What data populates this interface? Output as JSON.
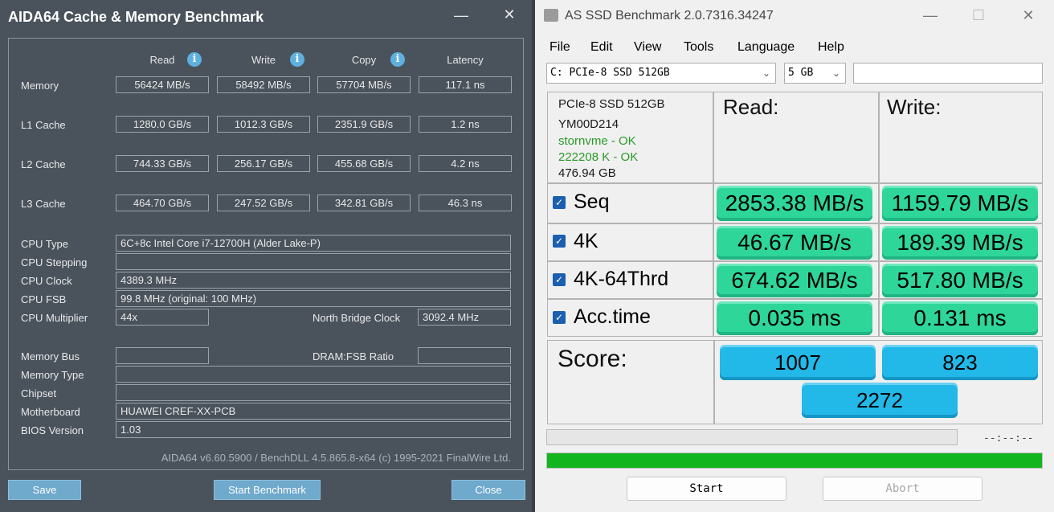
{
  "aida": {
    "title": "AIDA64 Cache & Memory Benchmark",
    "headers": [
      "Read",
      "Write",
      "Copy",
      "Latency"
    ],
    "rows": [
      {
        "label": "Memory",
        "values": [
          "56424 MB/s",
          "58492 MB/s",
          "57704 MB/s",
          "117.1 ns"
        ]
      },
      {
        "label": "L1 Cache",
        "values": [
          "1280.0 GB/s",
          "1012.3 GB/s",
          "2351.9 GB/s",
          "1.2 ns"
        ]
      },
      {
        "label": "L2 Cache",
        "values": [
          "744.33 GB/s",
          "256.17 GB/s",
          "455.68 GB/s",
          "4.2 ns"
        ]
      },
      {
        "label": "L3 Cache",
        "values": [
          "464.70 GB/s",
          "247.52 GB/s",
          "342.81 GB/s",
          "46.3 ns"
        ]
      }
    ],
    "cpu": {
      "type_label": "CPU Type",
      "type": "6C+8c Intel Core i7-12700H  (Alder Lake-P)",
      "stepping_label": "CPU Stepping",
      "stepping": "",
      "clock_label": "CPU Clock",
      "clock": "4389.3 MHz",
      "fsb_label": "CPU FSB",
      "fsb": "99.8 MHz  (original: 100 MHz)",
      "multiplier_label": "CPU Multiplier",
      "multiplier": "44x",
      "nb_clock_label": "North Bridge Clock",
      "nb_clock": "3092.4 MHz"
    },
    "system": {
      "mem_bus_label": "Memory Bus",
      "mem_bus": "",
      "dram_ratio_label": "DRAM:FSB Ratio",
      "dram_ratio": "",
      "mem_type_label": "Memory Type",
      "mem_type": "",
      "chipset_label": "Chipset",
      "chipset": "",
      "motherboard_label": "Motherboard",
      "motherboard": "HUAWEI CREF-XX-PCB",
      "bios_label": "BIOS Version",
      "bios": "1.03"
    },
    "footer": "AIDA64 v6.60.5900 / BenchDLL 4.5.865.8-x64  (c) 1995-2021 FinalWire Ltd.",
    "buttons": {
      "save": "Save",
      "start": "Start Benchmark",
      "close": "Close"
    },
    "colors": {
      "background": "#4a535c",
      "button": "#6fa9cc",
      "info_icon": "#5fb0e0"
    }
  },
  "asssd": {
    "title": "AS SSD Benchmark 2.0.7316.34247",
    "menu": [
      "File",
      "Edit",
      "View",
      "Tools",
      "Language",
      "Help"
    ],
    "drive_select": "C: PCIe-8 SSD 512GB",
    "size_select": "5 GB",
    "drive_info": {
      "model": "PCIe-8 SSD 512GB",
      "firmware": "YM00D214",
      "driver": "stornvme - OK",
      "alignment": "222208 K - OK",
      "capacity": "476.94 GB"
    },
    "read_header": "Read:",
    "write_header": "Write:",
    "tests": [
      {
        "label": "Seq",
        "checked": true,
        "read": "2853.38 MB/s",
        "write": "1159.79 MB/s"
      },
      {
        "label": "4K",
        "checked": true,
        "read": "46.67 MB/s",
        "write": "189.39 MB/s"
      },
      {
        "label": "4K-64Thrd",
        "checked": true,
        "read": "674.62 MB/s",
        "write": "517.80 MB/s"
      },
      {
        "label": "Acc.time",
        "checked": true,
        "read": "0.035 ms",
        "write": "0.131 ms"
      }
    ],
    "score_label": "Score:",
    "score_read": "1007",
    "score_write": "823",
    "score_total": "2272",
    "time": "--:--:--",
    "progress_top": 0,
    "progress_bottom": 1,
    "buttons": {
      "start": "Start",
      "abort": "Abort"
    },
    "colors": {
      "result": "#2ed69a",
      "score": "#22b8e8",
      "progress": "#13b51e",
      "ok_text": "#2a9a2a"
    }
  }
}
